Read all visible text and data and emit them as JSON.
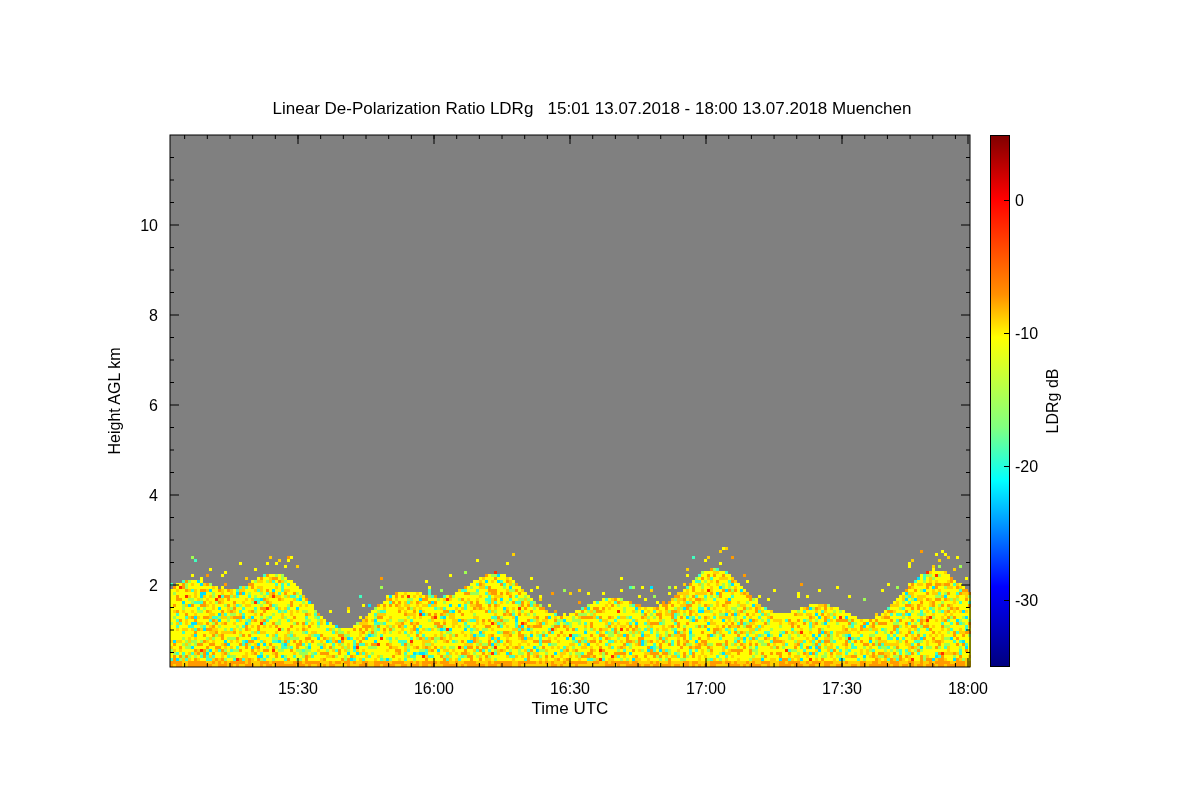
{
  "title": "Linear De-Polarization Ratio LDRg   15:01 13.07.2018 - 18:00 13.07.2018 Muenchen",
  "plot": {
    "ylabel": "Height AGL km",
    "xlabel": "Time UTC",
    "yticks": [
      "10",
      "8",
      "6",
      "4",
      "2"
    ],
    "xticks": [
      "15:30",
      "16:00",
      "16:30",
      "17:00",
      "17:30",
      "18:00"
    ]
  },
  "colorbar": {
    "label": "LDRg dB",
    "ticks": [
      "0",
      "-10",
      "-20",
      "-30"
    ]
  }
}
